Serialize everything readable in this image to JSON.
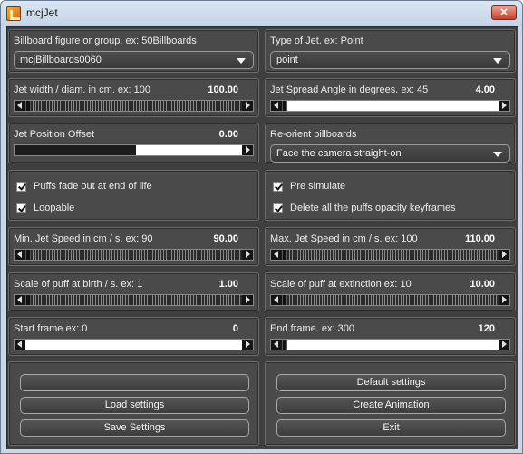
{
  "window": {
    "title": "mcjJet",
    "close_glyph": "✕"
  },
  "billboard": {
    "label": "Billboard figure or group. ex: 50Billboards",
    "value": "mcjBillboards0060"
  },
  "jet_type": {
    "label": "Type of Jet. ex: Point",
    "value": "point"
  },
  "jet_width": {
    "label": "Jet width / diam. in cm. ex: 100",
    "value": "100.00"
  },
  "spread_angle": {
    "label": "Jet Spread Angle in degrees. ex: 45",
    "value": "4.00"
  },
  "position_offset": {
    "label": "Jet Position Offset",
    "value": "0.00"
  },
  "reorient": {
    "label": "Re-orient billboards",
    "value": "Face the camera straight-on"
  },
  "checks_left": [
    {
      "label": "Puffs fade out at end of life",
      "checked": true
    },
    {
      "label": "Loopable",
      "checked": true
    }
  ],
  "checks_right": [
    {
      "label": "Pre simulate",
      "checked": true
    },
    {
      "label": "Delete all the puffs opacity keyframes",
      "checked": true
    }
  ],
  "min_speed": {
    "label": "Min. Jet Speed in cm / s. ex: 90",
    "value": "90.00"
  },
  "max_speed": {
    "label": "Max. Jet Speed in cm / s. ex: 100",
    "value": "110.00"
  },
  "scale_birth": {
    "label": "Scale of puff at birth / s. ex: 1",
    "value": "1.00"
  },
  "scale_extinction": {
    "label": "Scale of puff at extinction ex: 10",
    "value": "10.00"
  },
  "start_frame": {
    "label": "Start frame ex: 0",
    "value": "0"
  },
  "end_frame": {
    "label": "End frame. ex: 300",
    "value": "120"
  },
  "buttons_left": {
    "blank": "",
    "load": "Load settings",
    "save": "Save Settings"
  },
  "buttons_right": {
    "defaults": "Default settings",
    "create": "Create Animation",
    "exit": "Exit"
  }
}
